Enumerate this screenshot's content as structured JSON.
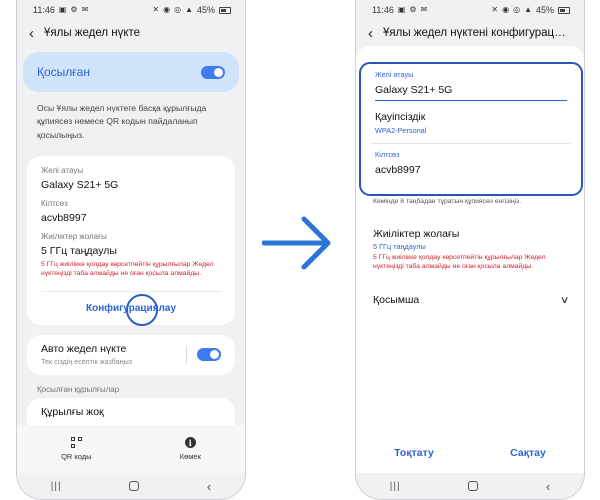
{
  "left": {
    "status": {
      "time": "11:46",
      "battery": "45%"
    },
    "title": "Ұялы жедел нүкте",
    "connected_label": "Қосылған",
    "description": "Осы Ұялы жедел нүктеге басқа құрылғыда құпиясөз немесе QR кодын пайдаланып қосылыңыз.",
    "network_name_label": "Желі атауы",
    "network_name_value": "Galaxy S21+ 5G",
    "password_label": "Кілтсөз",
    "password_value": "acvb8997",
    "band_label": "Жиіліктер жолағы",
    "band_value": "5 ГГц таңдаулы",
    "band_warning": "5 ГГц жиілікке қолдау көрсетпейтін құрылғылар Жедел нүктеңізді таба алмайды не оған қосыла алмайды.",
    "configure_label": "Конфигурациялау",
    "auto_title": "Авто жедел нүкте",
    "auto_subtitle": "Тек сіздің есептік жазбаңыз",
    "connected_devices_header": "Қосылған құрылғылар",
    "no_devices": "Құрылғы жоқ",
    "tab_qr": "QR коды",
    "tab_help": "Көмек"
  },
  "right": {
    "status": {
      "time": "11:46",
      "battery": "45%"
    },
    "title": "Ұялы жедел нүктені конфигурация...",
    "network_name_label": "Желі атауы",
    "network_name_value": "Galaxy S21+ 5G",
    "security_label": "Қауіпсіздік",
    "security_value": "WPA2-Personal",
    "password_label": "Кілтсөз",
    "password_value": "acvb8997",
    "password_hint": "Кемінде 8 таңбадан тұратын құпиясөз енгізіңіз.",
    "band_label": "Жиіліктер жолағы",
    "band_value": "5 ГГц таңдаулы",
    "band_warning": "5 ГГц жиілікке қолдау көрсетпейтін құрылғылар Жедел нүктеңізді таба алмайды не оған қосыла алмайды.",
    "extra_label": "Қосымша",
    "cancel_label": "Тоқтату",
    "save_label": "Сақтау"
  },
  "colors": {
    "accent": "#2c62d9",
    "warning": "#d41f2e",
    "highlight": "#cfe3fb",
    "arrow": "#2b73d6"
  },
  "icons": [
    "back-arrow-icon",
    "toggle-switch",
    "qr-code-icon",
    "info-icon",
    "chevron-down-icon",
    "right-arrow-icon"
  ]
}
